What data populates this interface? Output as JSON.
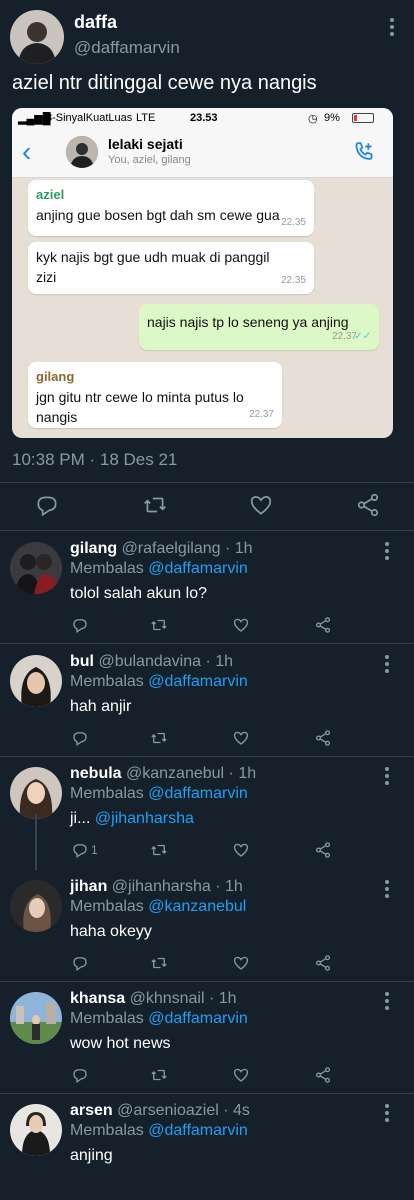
{
  "tweet": {
    "name": "daffa",
    "handle": "@daffamarvin",
    "text": "aziel ntr ditinggal cewe nya nangis",
    "date": "10:38 PM · 18 Des 21"
  },
  "screenshot": {
    "status": {
      "carrier": "3-SinyalKuatLuas",
      "network": "LTE",
      "time": "23.53",
      "battery": "9%"
    },
    "chat_title": "lelaki sejati",
    "chat_members": "You, aziel, gilang",
    "messages": [
      {
        "sender": "aziel",
        "text": "anjing gue bosen bgt dah sm cewe gua",
        "time": "22.35",
        "direction": "in"
      },
      {
        "sender": "",
        "text": "kyk najis bgt gue udh muak di panggil zizi",
        "time": "22.35",
        "direction": "in"
      },
      {
        "sender": "",
        "text": "najis najis tp lo seneng ya anjing",
        "time": "22.37",
        "direction": "out"
      },
      {
        "sender": "gilang",
        "text": "jgn gitu ntr cewe lo minta putus lo nangis",
        "time": "22.37",
        "direction": "in"
      }
    ],
    "colors": {
      "bg": "#e7ded5",
      "in_bubble": "#ffffff",
      "out_bubble": "#dcf8c6",
      "accent": "#1a85e6",
      "aziel": "#2b9c6a",
      "gilang": "#8b6a2f"
    }
  },
  "replies": [
    {
      "name": "gilang",
      "handle": "@rafaelgilang",
      "time": "1h",
      "replying_label": "Membalas",
      "replying_to": "@daffamarvin",
      "text": "tolol salah akun lo?",
      "mention": "",
      "reply_count": ""
    },
    {
      "name": "bul",
      "handle": "@bulandavina",
      "time": "1h",
      "replying_label": "Membalas",
      "replying_to": "@daffamarvin",
      "text": "hah anjir",
      "mention": "",
      "reply_count": ""
    },
    {
      "name": "nebula",
      "handle": "@kanzanebul",
      "time": "1h",
      "replying_label": "Membalas",
      "replying_to": "@daffamarvin",
      "text": "ji...",
      "mention": "@jihanharsha",
      "reply_count": "1"
    },
    {
      "name": "jihan",
      "handle": "@jihanharsha",
      "time": "1h",
      "replying_label": "Membalas",
      "replying_to": "@kanzanebul",
      "text": "haha okeyy",
      "mention": "",
      "reply_count": ""
    },
    {
      "name": "khansa",
      "handle": "@khnsnail",
      "time": "1h",
      "replying_label": "Membalas",
      "replying_to": "@daffamarvin",
      "text": "wow hot news",
      "mention": "",
      "reply_count": ""
    },
    {
      "name": "arsen",
      "handle": "@arsenioaziel",
      "time": "4s",
      "replying_label": "Membalas",
      "replying_to": "@daffamarvin",
      "text": "anjing",
      "mention": "",
      "reply_count": ""
    }
  ],
  "icons": [
    "more-icon",
    "reply-icon",
    "retweet-icon",
    "like-icon",
    "share-icon",
    "call-icon",
    "back-icon"
  ],
  "colors": {
    "background": "#15202b",
    "muted": "#8899a6",
    "link": "#1da1f2",
    "divider": "#38444d"
  }
}
